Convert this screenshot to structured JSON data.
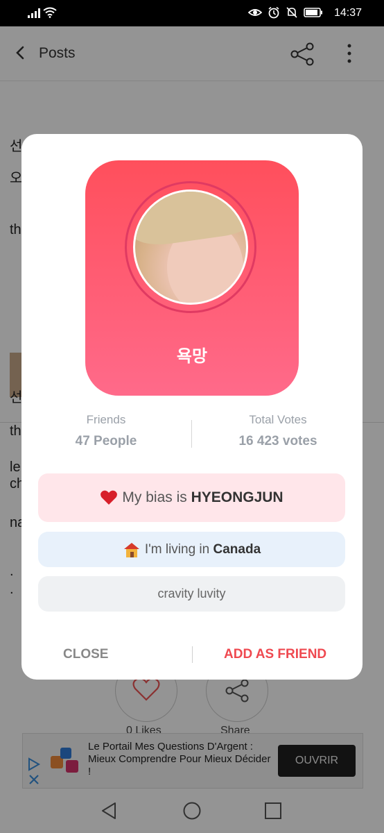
{
  "status_bar": {
    "time": "14:37"
  },
  "app_bar": {
    "title": "Posts"
  },
  "background": {
    "lines": [
      "선",
      "오",
      "th",
      "선",
      "th",
      "le",
      "ch",
      "na",
      ".",
      "."
    ],
    "likes_label": "0 Likes",
    "share_label": "Share"
  },
  "profile": {
    "name": "욕망",
    "friends_label": "Friends",
    "friends_value": "47 People",
    "votes_label": "Total Votes",
    "votes_value": "16 423 votes",
    "bias_prefix": "My bias is ",
    "bias_name": "HYEONGJUN",
    "living_prefix": "I'm living in ",
    "living_place": "Canada",
    "bio": "cravity luvity",
    "accent_color": "#ef4950"
  },
  "dialog_actions": {
    "close": "CLOSE",
    "add_friend": "ADD AS FRIEND"
  },
  "ad": {
    "text": "Le Portail Mes Questions D'Argent : Mieux Comprendre Pour Mieux Décider !",
    "button": "OUVRIR"
  }
}
